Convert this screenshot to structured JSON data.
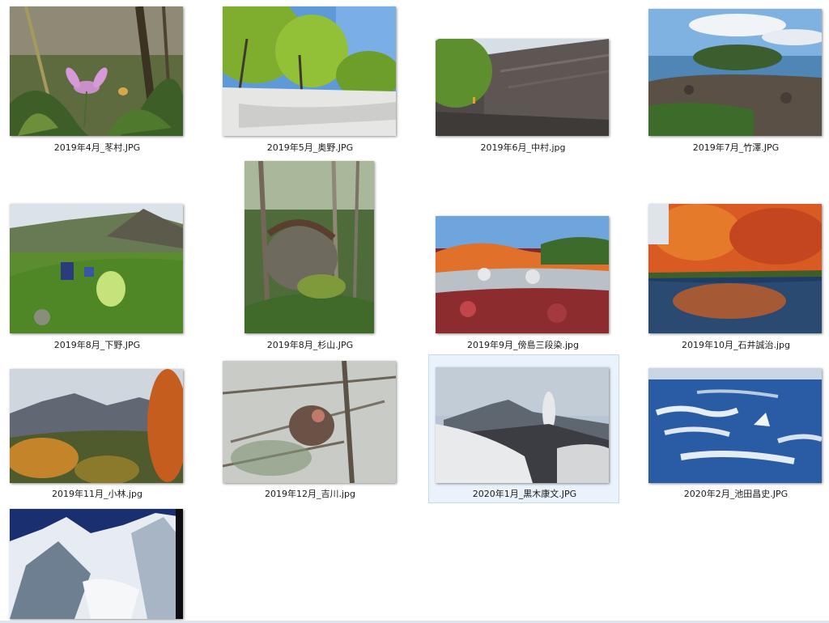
{
  "window": {
    "view_mode": "large-icons",
    "selected_index": 10
  },
  "files": [
    {
      "name": "2019年4月_苳村.JPG",
      "thumb_icon": "dogtooth-violet-flower-photo",
      "selected": false
    },
    {
      "name": "2019年5月_奥野.JPG",
      "thumb_icon": "snowfield-beech-forest-photo",
      "selected": false
    },
    {
      "name": "2019年6月_中村.jpg",
      "thumb_icon": "volcanic-ash-valley-hikers-photo",
      "selected": false
    },
    {
      "name": "2019年7月_竹澤.JPG",
      "thumb_icon": "rocky-coast-island-photo",
      "selected": false
    },
    {
      "name": "2019年8月_下野.JPG",
      "thumb_icon": "alpine-meadow-hikers-photo",
      "selected": false
    },
    {
      "name": "2019年8月_杉山.JPG",
      "thumb_icon": "forest-tree-roots-rock-photo",
      "selected": false
    },
    {
      "name": "2019年9月_傍島三段染.jpg",
      "thumb_icon": "autumn-colors-mountainside-photo",
      "selected": false
    },
    {
      "name": "2019年10月_石井誠治.jpg",
      "thumb_icon": "autumn-pond-reflection-photo",
      "selected": false
    },
    {
      "name": "2019年11月_小林.jpg",
      "thumb_icon": "autumn-mountains-clouds-photo",
      "selected": false
    },
    {
      "name": "2019年12月_吉川.jpg",
      "thumb_icon": "snow-monkey-in-tree-photo",
      "selected": false
    },
    {
      "name": "2020年1月_黒木康文.JPG",
      "thumb_icon": "snowy-volcano-fumarole-photo",
      "selected": true
    },
    {
      "name": "2020年2月_池田昌史.JPG",
      "thumb_icon": "drift-ice-sea-photo",
      "selected": false
    },
    {
      "name": "",
      "thumb_icon": "snow-mountain-glacier-photo",
      "selected": false
    }
  ]
}
